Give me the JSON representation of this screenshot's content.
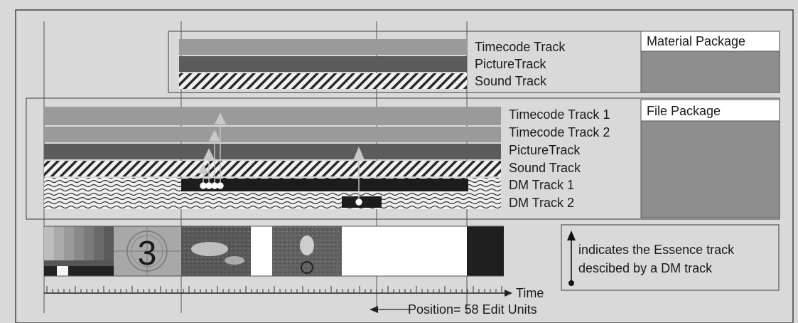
{
  "material_package": {
    "title": "Material Package",
    "tracks": [
      "Timecode Track",
      "PictureTrack",
      "Sound Track"
    ]
  },
  "file_package": {
    "title": "File Package",
    "tracks": [
      "Timecode Track 1",
      "Timecode Track 2",
      "PictureTrack",
      "Sound Track",
      "DM Track 1",
      "DM Track 2"
    ]
  },
  "frames": {
    "countdown_number": "3"
  },
  "legend": {
    "line1": "indicates the Essence track",
    "line2": "descibed by a DM track"
  },
  "timeline": {
    "axis_label": "Time",
    "position_label": "Position= 58 Edit Units"
  },
  "colors": {
    "background": "#d9d9d9",
    "timecode_track": "#9a9a9a",
    "picture_track": "#5c5c5c",
    "package_fill": "#8e8e8e",
    "dm_track": "#1c1c1c",
    "arrow": "#c8c8c8"
  }
}
